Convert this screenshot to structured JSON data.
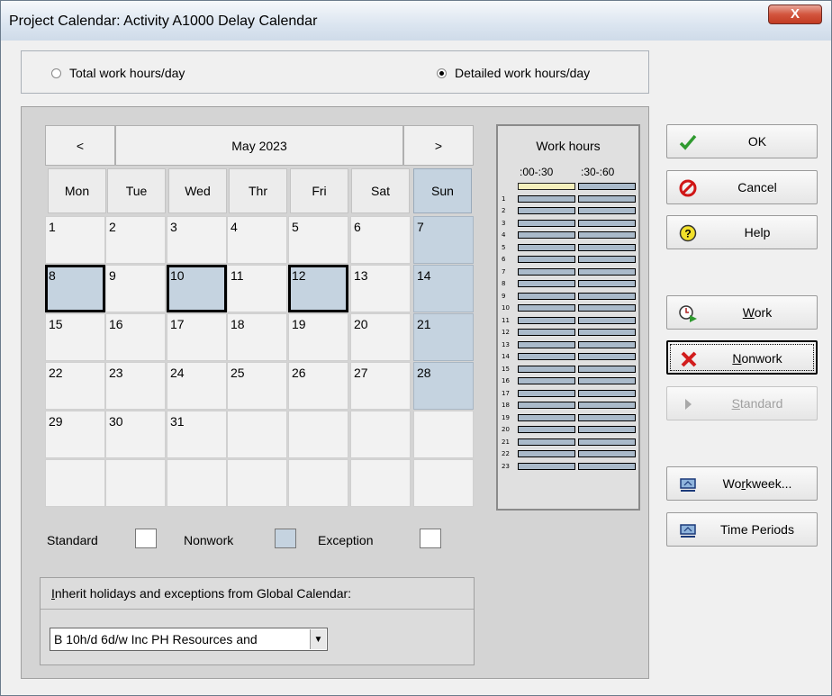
{
  "window": {
    "title": "Project Calendar: Activity A1000 Delay Calendar",
    "close_glyph": "X"
  },
  "mode": {
    "total_label": "Total work hours/day",
    "detailed_label": "Detailed work hours/day",
    "selected": "detailed"
  },
  "calendar": {
    "prev": "<",
    "next": ">",
    "month_label": "May 2023",
    "weekdays": [
      "Mon",
      "Tue",
      "Wed",
      "Thr",
      "Fri",
      "Sat",
      "Sun"
    ],
    "weeks": [
      [
        "1",
        "2",
        "3",
        "4",
        "5",
        "6",
        "7"
      ],
      [
        "8",
        "9",
        "10",
        "11",
        "12",
        "13",
        "14"
      ],
      [
        "15",
        "16",
        "17",
        "18",
        "19",
        "20",
        "21"
      ],
      [
        "22",
        "23",
        "24",
        "25",
        "26",
        "27",
        "28"
      ],
      [
        "29",
        "30",
        "31",
        "",
        "",
        "",
        ""
      ],
      [
        "",
        "",
        "",
        "",
        "",
        "",
        ""
      ]
    ],
    "selected_days": [
      "8",
      "10",
      "12"
    ]
  },
  "work_hours": {
    "title": "Work hours",
    "col1": ":00-:30",
    "col2": ":30-:60",
    "hours": [
      "",
      "1",
      "2",
      "3",
      "4",
      "5",
      "6",
      "7",
      "8",
      "9",
      "10",
      "11",
      "12",
      "13",
      "14",
      "15",
      "16",
      "17",
      "18",
      "19",
      "20",
      "21",
      "22",
      "23"
    ]
  },
  "legend": {
    "standard": "Standard",
    "nonwork": "Nonwork",
    "exception": "Exception"
  },
  "inherit": {
    "label_first": "I",
    "label_rest": "nherit holidays and exceptions from Global Calendar:",
    "value": "B 10h/d 6d/w Inc PH Resources and"
  },
  "buttons": {
    "ok": "OK",
    "cancel": "Cancel",
    "help": "Help",
    "work_u": "W",
    "work_rest": "ork",
    "nonwork_u": "N",
    "nonwork_rest": "onwork",
    "standard_u": "S",
    "standard_rest": "tandard",
    "workweek_a": "Wo",
    "workweek_u": "r",
    "workweek_b": "kweek...",
    "time_periods": "Time Periods"
  },
  "colors": {
    "nonwork": "#c5d3e0",
    "hour_slot": "#aabaca",
    "hour_slot_highlight": "#f5efbc"
  }
}
